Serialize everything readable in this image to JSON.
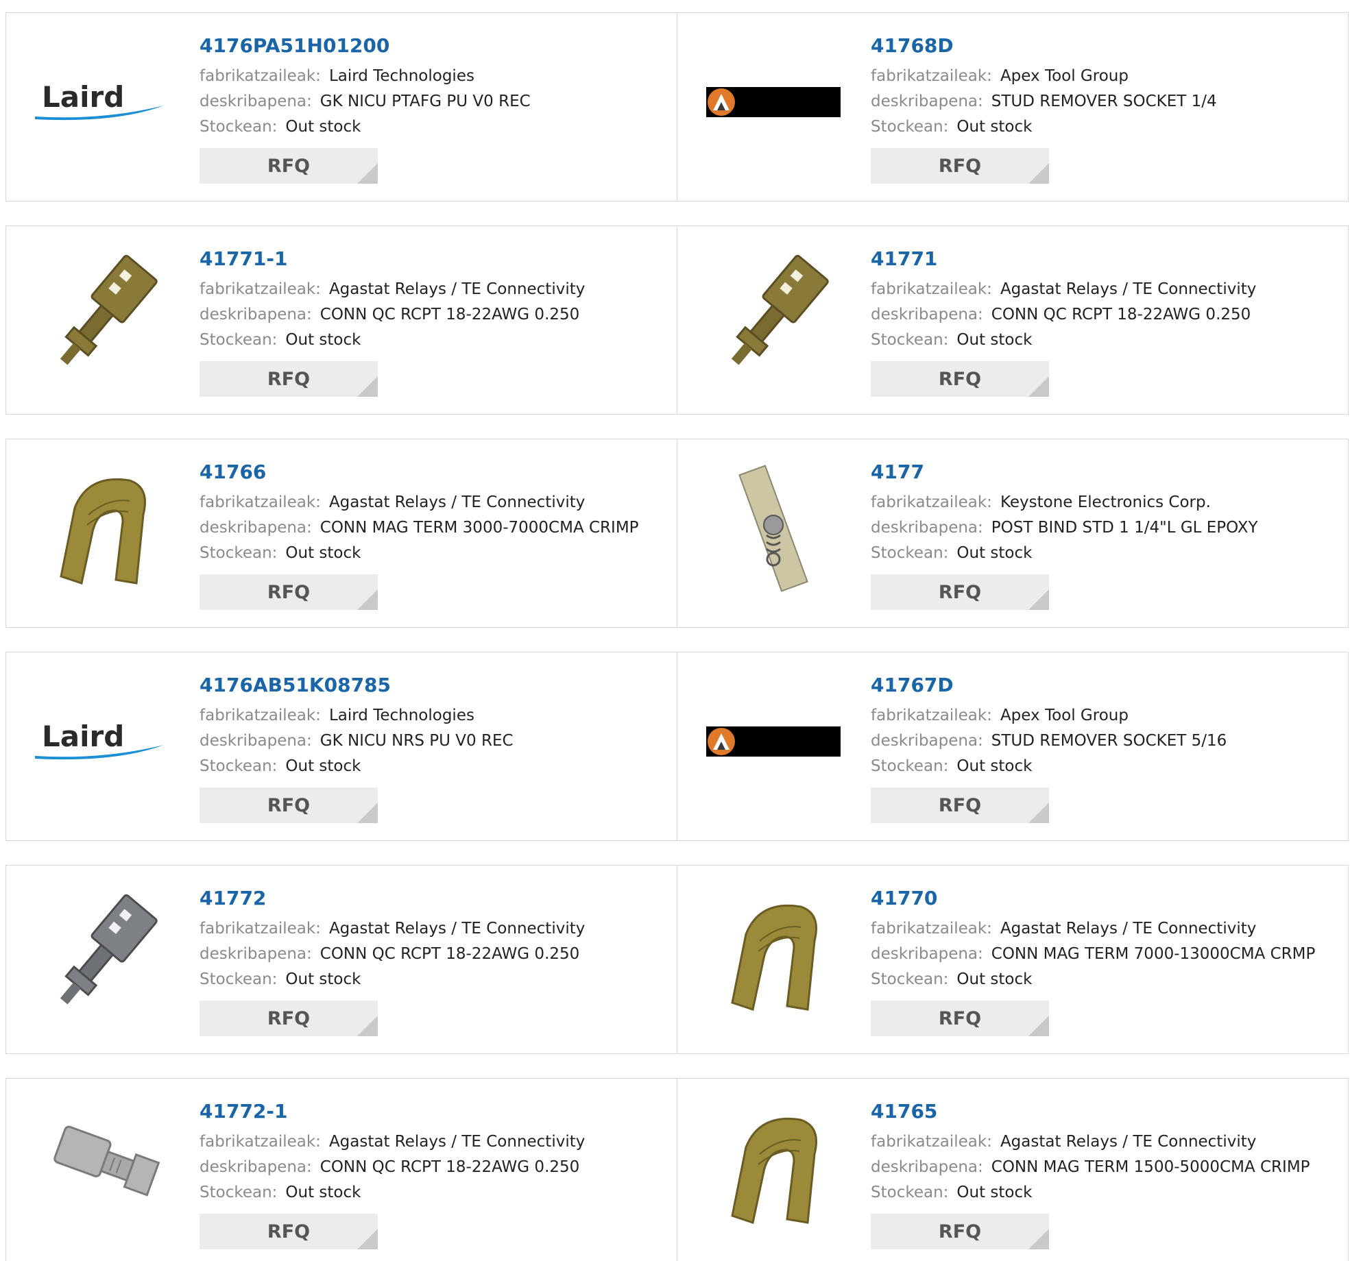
{
  "labels": {
    "manufacturer": "fabrikatzaileak:",
    "description": "deskribapena:",
    "stock": "Stockean:",
    "rfq": "RFQ"
  },
  "products": [
    {
      "part": "4176PA51H01200",
      "manufacturer": "Laird Technologies",
      "description": "GK NICU PTAFG PU V0 REC",
      "stock": "Out stock",
      "image": "laird-logo"
    },
    {
      "part": "41768D",
      "manufacturer": "Apex Tool Group",
      "description": "STUD REMOVER SOCKET 1/4",
      "stock": "Out stock",
      "image": "apex-logo"
    },
    {
      "part": "41771-1",
      "manufacturer": "Agastat Relays / TE Connectivity",
      "description": "CONN QC RCPT 18-22AWG 0.250",
      "stock": "Out stock",
      "image": "qc-receptacle-brass-icon"
    },
    {
      "part": "41771",
      "manufacturer": "Agastat Relays / TE Connectivity",
      "description": "CONN QC RCPT 18-22AWG 0.250",
      "stock": "Out stock",
      "image": "qc-receptacle-brass-icon"
    },
    {
      "part": "41766",
      "manufacturer": "Agastat Relays / TE Connectivity",
      "description": "CONN MAG TERM 3000-7000CMA CRIMP",
      "stock": "Out stock",
      "image": "mag-term-icon"
    },
    {
      "part": "4177",
      "manufacturer": "Keystone Electronics Corp.",
      "description": "POST BIND STD 1 1/4\"L GL EPOXY",
      "stock": "Out stock",
      "image": "binding-post-icon"
    },
    {
      "part": "4176AB51K08785",
      "manufacturer": "Laird Technologies",
      "description": "GK NICU NRS PU V0 REC",
      "stock": "Out stock",
      "image": "laird-logo"
    },
    {
      "part": "41767D",
      "manufacturer": "Apex Tool Group",
      "description": "STUD REMOVER SOCKET 5/16",
      "stock": "Out stock",
      "image": "apex-logo"
    },
    {
      "part": "41772",
      "manufacturer": "Agastat Relays / TE Connectivity",
      "description": "CONN QC RCPT 18-22AWG 0.250",
      "stock": "Out stock",
      "image": "qc-receptacle-gray-icon"
    },
    {
      "part": "41770",
      "manufacturer": "Agastat Relays / TE Connectivity",
      "description": "CONN MAG TERM 7000-13000CMA CRMP",
      "stock": "Out stock",
      "image": "mag-term-icon"
    },
    {
      "part": "41772-1",
      "manufacturer": "Agastat Relays / TE Connectivity",
      "description": "CONN QC RCPT 18-22AWG 0.250",
      "stock": "Out stock",
      "image": "qc-receptacle-silver-icon"
    },
    {
      "part": "41765",
      "manufacturer": "Agastat Relays / TE Connectivity",
      "description": "CONN MAG TERM 1500-5000CMA CRIMP",
      "stock": "Out stock",
      "image": "mag-term-icon"
    }
  ],
  "colors": {
    "part_link": "#1a64a8",
    "label": "#8a8a8a",
    "rfq_bg": "#ececec",
    "laird_blue": "#1a8fd6",
    "brass": "#8a7a3a"
  }
}
